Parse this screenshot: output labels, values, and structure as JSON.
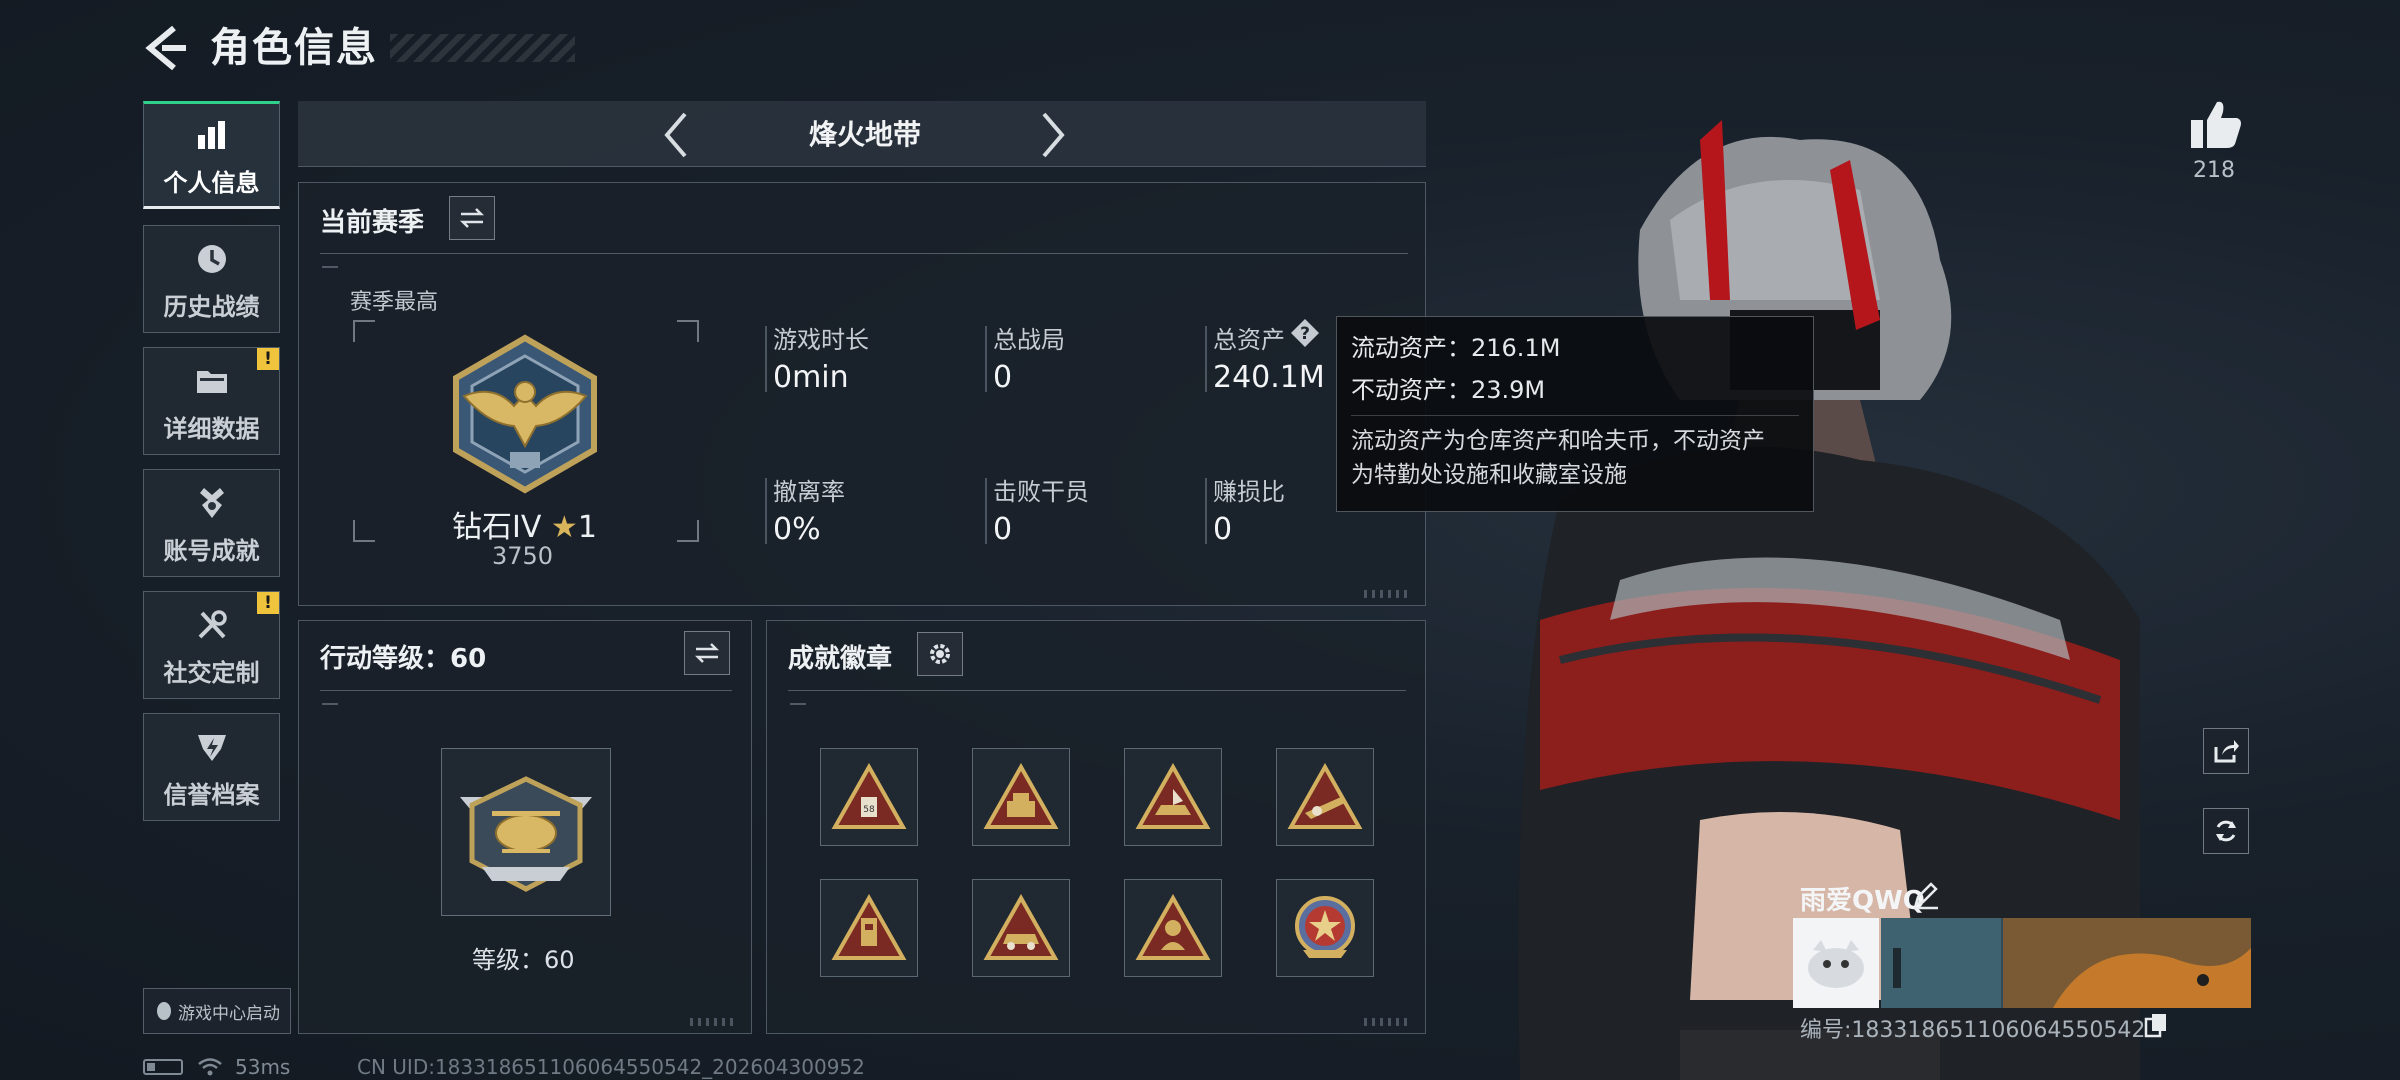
{
  "header": {
    "title": "角色信息"
  },
  "nav": {
    "items": [
      {
        "label": "个人信息",
        "icon": "bar-chart-icon",
        "active": true,
        "badge": ""
      },
      {
        "label": "历史战绩",
        "icon": "clock-icon",
        "active": false,
        "badge": ""
      },
      {
        "label": "详细数据",
        "icon": "folder-icon",
        "active": false,
        "badge": "!"
      },
      {
        "label": "账号成就",
        "icon": "medal-icon",
        "active": false,
        "badge": ""
      },
      {
        "label": "社交定制",
        "icon": "tools-icon",
        "active": false,
        "badge": "!"
      },
      {
        "label": "信誉档案",
        "icon": "shield-icon",
        "active": false,
        "badge": ""
      }
    ],
    "game_center_label": "游戏中心启动"
  },
  "status_bar": {
    "ping": "53ms",
    "uid_line": "CN UID:1833186511060645505​42_202604300952"
  },
  "mode": {
    "title": "烽火地带"
  },
  "season": {
    "title": "当前赛季",
    "best_label": "赛季最高",
    "rank_name": "钻石IV",
    "rank_stars": "1",
    "rank_points": "3750",
    "stats": [
      {
        "label": "游戏时长",
        "value": "0min"
      },
      {
        "label": "总战局",
        "value": "0"
      },
      {
        "label": "总资产",
        "value": "240.1M"
      },
      {
        "label": "撤离率",
        "value": "0%"
      },
      {
        "label": "击败干员",
        "value": "0"
      },
      {
        "label": "赚损比",
        "value": "0"
      }
    ]
  },
  "tooltip": {
    "liquid": "流动资产：216.1M",
    "fixed": "不动资产：23.9M",
    "desc_line1": "流动资产为仓库资产和哈夫币，不动资产",
    "desc_line2": "为特勤处设施和收藏室设施"
  },
  "action_level": {
    "title": "行动等级：60",
    "level_label": "等级：60"
  },
  "achievements": {
    "title": "成就徽章"
  },
  "profile": {
    "likes": "218",
    "player_name": "雨爱QWQ",
    "player_id": "编号:18331865110606455054​2"
  },
  "colors": {
    "accent_green": "#2fd08a",
    "badge_yellow": "#f0c33c",
    "gold": "#c9a74f"
  }
}
